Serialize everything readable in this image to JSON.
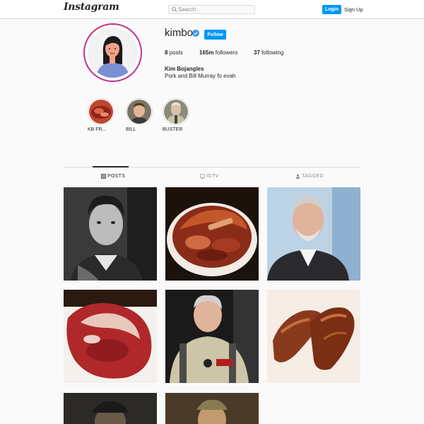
{
  "header": {
    "logo": "Instagram",
    "search_placeholder": "Search",
    "login_label": "Login",
    "signup_label": "Sign Up"
  },
  "profile": {
    "username": "kimbo",
    "verified": true,
    "follow_label": "Follow",
    "posts_count": "8",
    "posts_label": "posts",
    "followers_count": "165m",
    "followers_label": "followers",
    "following_count": "37",
    "following_label": "following",
    "full_name": "Kim Bojangles",
    "bio": "Pork and Bill Murray fo evah"
  },
  "highlights": [
    {
      "label": "KB FR..."
    },
    {
      "label": "BILL"
    },
    {
      "label": "BUSTER"
    }
  ],
  "tabs": [
    {
      "label": "POSTS",
      "icon": "grid-icon",
      "active": true
    },
    {
      "label": "IGTV",
      "icon": "tv-icon",
      "active": false
    },
    {
      "label": "TAGGED",
      "icon": "tag-icon",
      "active": false
    }
  ],
  "colors": {
    "accent": "#0095f6",
    "ring": "#c13584",
    "border": "#dbdbdb"
  }
}
